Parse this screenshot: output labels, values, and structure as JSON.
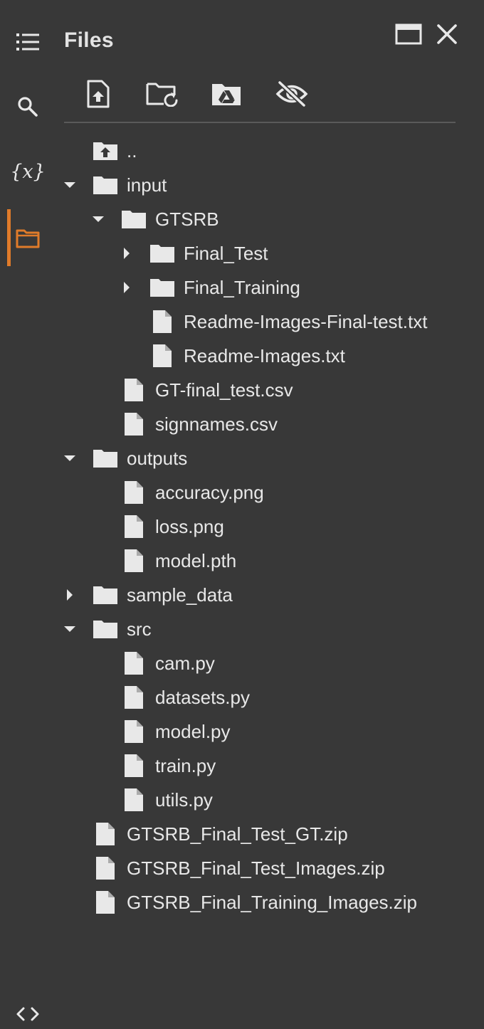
{
  "panel": {
    "title": "Files"
  },
  "rail": {
    "items": [
      {
        "name": "table-of-contents",
        "icon": "list-icon"
      },
      {
        "name": "search",
        "icon": "search-icon"
      },
      {
        "name": "variables",
        "icon": "variables-icon",
        "glyph": "{x}"
      },
      {
        "name": "files",
        "icon": "folder-outline-icon",
        "active": true
      }
    ],
    "bottom": {
      "name": "code-snippets",
      "icon": "code-brackets-icon"
    }
  },
  "window_controls": [
    {
      "name": "open-in-tab",
      "icon": "window-icon"
    },
    {
      "name": "close",
      "icon": "close-icon"
    }
  ],
  "toolbar": [
    {
      "name": "upload-file",
      "icon": "file-upload-icon"
    },
    {
      "name": "refresh",
      "icon": "folder-refresh-icon"
    },
    {
      "name": "mount-drive",
      "icon": "drive-folder-icon"
    },
    {
      "name": "toggle-hidden",
      "icon": "eye-off-icon"
    }
  ],
  "tree": [
    {
      "label": "..",
      "type": "parent"
    },
    {
      "label": "input",
      "type": "folder",
      "expanded": true
    },
    {
      "label": "GTSRB",
      "type": "folder",
      "expanded": true
    },
    {
      "label": "Final_Test",
      "type": "folder",
      "expanded": false
    },
    {
      "label": "Final_Training",
      "type": "folder",
      "expanded": false
    },
    {
      "label": "Readme-Images-Final-test.txt",
      "type": "file"
    },
    {
      "label": "Readme-Images.txt",
      "type": "file"
    },
    {
      "label": "GT-final_test.csv",
      "type": "file"
    },
    {
      "label": "signnames.csv",
      "type": "file"
    },
    {
      "label": "outputs",
      "type": "folder",
      "expanded": true
    },
    {
      "label": "accuracy.png",
      "type": "file"
    },
    {
      "label": "loss.png",
      "type": "file"
    },
    {
      "label": "model.pth",
      "type": "file"
    },
    {
      "label": "sample_data",
      "type": "folder",
      "expanded": false
    },
    {
      "label": "src",
      "type": "folder",
      "expanded": true
    },
    {
      "label": "cam.py",
      "type": "file"
    },
    {
      "label": "datasets.py",
      "type": "file"
    },
    {
      "label": "model.py",
      "type": "file"
    },
    {
      "label": "train.py",
      "type": "file"
    },
    {
      "label": "utils.py",
      "type": "file"
    },
    {
      "label": "GTSRB_Final_Test_GT.zip",
      "type": "file"
    },
    {
      "label": "GTSRB_Final_Test_Images.zip",
      "type": "file"
    },
    {
      "label": "GTSRB_Final_Training_Images.zip",
      "type": "file"
    }
  ],
  "colors": {
    "background": "#383838",
    "icon": "#e8e8e8",
    "text": "#e8e8e8",
    "active_accent": "#e07b2a",
    "divider": "#5a5a5a"
  }
}
